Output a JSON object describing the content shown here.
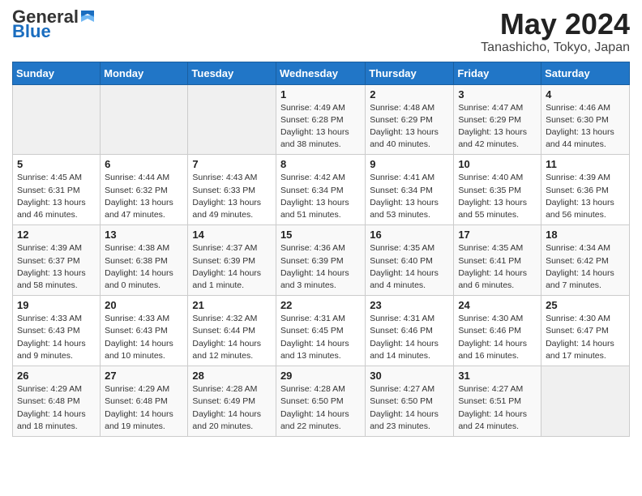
{
  "header": {
    "logo_general": "General",
    "logo_blue": "Blue",
    "month_title": "May 2024",
    "location": "Tanashicho, Tokyo, Japan"
  },
  "weekdays": [
    "Sunday",
    "Monday",
    "Tuesday",
    "Wednesday",
    "Thursday",
    "Friday",
    "Saturday"
  ],
  "weeks": [
    [
      {
        "day": "",
        "info": ""
      },
      {
        "day": "",
        "info": ""
      },
      {
        "day": "",
        "info": ""
      },
      {
        "day": "1",
        "info": "Sunrise: 4:49 AM\nSunset: 6:28 PM\nDaylight: 13 hours\nand 38 minutes."
      },
      {
        "day": "2",
        "info": "Sunrise: 4:48 AM\nSunset: 6:29 PM\nDaylight: 13 hours\nand 40 minutes."
      },
      {
        "day": "3",
        "info": "Sunrise: 4:47 AM\nSunset: 6:29 PM\nDaylight: 13 hours\nand 42 minutes."
      },
      {
        "day": "4",
        "info": "Sunrise: 4:46 AM\nSunset: 6:30 PM\nDaylight: 13 hours\nand 44 minutes."
      }
    ],
    [
      {
        "day": "5",
        "info": "Sunrise: 4:45 AM\nSunset: 6:31 PM\nDaylight: 13 hours\nand 46 minutes."
      },
      {
        "day": "6",
        "info": "Sunrise: 4:44 AM\nSunset: 6:32 PM\nDaylight: 13 hours\nand 47 minutes."
      },
      {
        "day": "7",
        "info": "Sunrise: 4:43 AM\nSunset: 6:33 PM\nDaylight: 13 hours\nand 49 minutes."
      },
      {
        "day": "8",
        "info": "Sunrise: 4:42 AM\nSunset: 6:34 PM\nDaylight: 13 hours\nand 51 minutes."
      },
      {
        "day": "9",
        "info": "Sunrise: 4:41 AM\nSunset: 6:34 PM\nDaylight: 13 hours\nand 53 minutes."
      },
      {
        "day": "10",
        "info": "Sunrise: 4:40 AM\nSunset: 6:35 PM\nDaylight: 13 hours\nand 55 minutes."
      },
      {
        "day": "11",
        "info": "Sunrise: 4:39 AM\nSunset: 6:36 PM\nDaylight: 13 hours\nand 56 minutes."
      }
    ],
    [
      {
        "day": "12",
        "info": "Sunrise: 4:39 AM\nSunset: 6:37 PM\nDaylight: 13 hours\nand 58 minutes."
      },
      {
        "day": "13",
        "info": "Sunrise: 4:38 AM\nSunset: 6:38 PM\nDaylight: 14 hours\nand 0 minutes."
      },
      {
        "day": "14",
        "info": "Sunrise: 4:37 AM\nSunset: 6:39 PM\nDaylight: 14 hours\nand 1 minute."
      },
      {
        "day": "15",
        "info": "Sunrise: 4:36 AM\nSunset: 6:39 PM\nDaylight: 14 hours\nand 3 minutes."
      },
      {
        "day": "16",
        "info": "Sunrise: 4:35 AM\nSunset: 6:40 PM\nDaylight: 14 hours\nand 4 minutes."
      },
      {
        "day": "17",
        "info": "Sunrise: 4:35 AM\nSunset: 6:41 PM\nDaylight: 14 hours\nand 6 minutes."
      },
      {
        "day": "18",
        "info": "Sunrise: 4:34 AM\nSunset: 6:42 PM\nDaylight: 14 hours\nand 7 minutes."
      }
    ],
    [
      {
        "day": "19",
        "info": "Sunrise: 4:33 AM\nSunset: 6:43 PM\nDaylight: 14 hours\nand 9 minutes."
      },
      {
        "day": "20",
        "info": "Sunrise: 4:33 AM\nSunset: 6:43 PM\nDaylight: 14 hours\nand 10 minutes."
      },
      {
        "day": "21",
        "info": "Sunrise: 4:32 AM\nSunset: 6:44 PM\nDaylight: 14 hours\nand 12 minutes."
      },
      {
        "day": "22",
        "info": "Sunrise: 4:31 AM\nSunset: 6:45 PM\nDaylight: 14 hours\nand 13 minutes."
      },
      {
        "day": "23",
        "info": "Sunrise: 4:31 AM\nSunset: 6:46 PM\nDaylight: 14 hours\nand 14 minutes."
      },
      {
        "day": "24",
        "info": "Sunrise: 4:30 AM\nSunset: 6:46 PM\nDaylight: 14 hours\nand 16 minutes."
      },
      {
        "day": "25",
        "info": "Sunrise: 4:30 AM\nSunset: 6:47 PM\nDaylight: 14 hours\nand 17 minutes."
      }
    ],
    [
      {
        "day": "26",
        "info": "Sunrise: 4:29 AM\nSunset: 6:48 PM\nDaylight: 14 hours\nand 18 minutes."
      },
      {
        "day": "27",
        "info": "Sunrise: 4:29 AM\nSunset: 6:48 PM\nDaylight: 14 hours\nand 19 minutes."
      },
      {
        "day": "28",
        "info": "Sunrise: 4:28 AM\nSunset: 6:49 PM\nDaylight: 14 hours\nand 20 minutes."
      },
      {
        "day": "29",
        "info": "Sunrise: 4:28 AM\nSunset: 6:50 PM\nDaylight: 14 hours\nand 22 minutes."
      },
      {
        "day": "30",
        "info": "Sunrise: 4:27 AM\nSunset: 6:50 PM\nDaylight: 14 hours\nand 23 minutes."
      },
      {
        "day": "31",
        "info": "Sunrise: 4:27 AM\nSunset: 6:51 PM\nDaylight: 14 hours\nand 24 minutes."
      },
      {
        "day": "",
        "info": ""
      }
    ]
  ]
}
